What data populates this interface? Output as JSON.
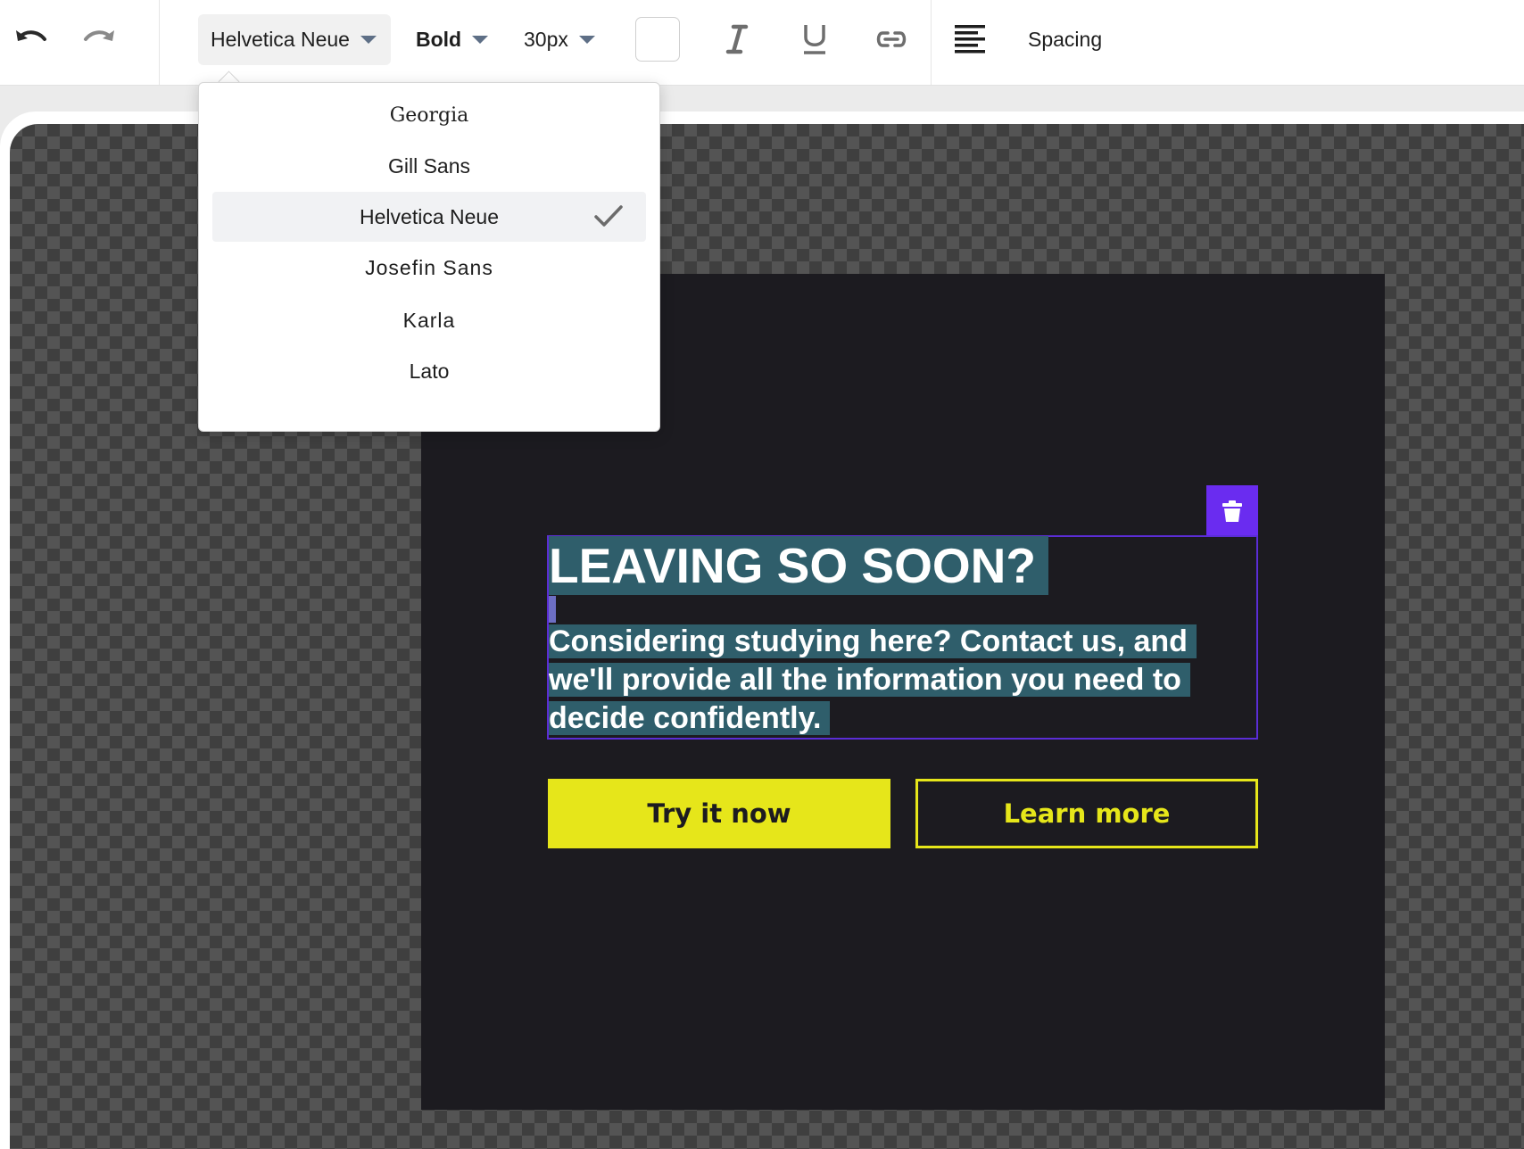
{
  "toolbar": {
    "font_family": "Helvetica Neue",
    "font_weight": "Bold",
    "font_size": "30px",
    "text_color": "#ffffff",
    "spacing_label": "Spacing"
  },
  "font_dropdown": {
    "options": [
      {
        "label": "Georgia",
        "selected": false
      },
      {
        "label": "Gill Sans",
        "selected": false
      },
      {
        "label": "Helvetica Neue",
        "selected": true
      },
      {
        "label": "Josefin Sans",
        "selected": false
      },
      {
        "label": "Karla",
        "selected": false
      },
      {
        "label": "Lato",
        "selected": false
      }
    ]
  },
  "popup": {
    "headline": "LEAVING SO SOON?",
    "body": "Considering studying here? Contact us, and we'll provide all the information you need to decide confidently.",
    "primary_button": "Try it now",
    "secondary_button": "Learn more"
  },
  "colors": {
    "accent": "#6a2cf0",
    "popup_background": "#1c1b20",
    "button_yellow": "#e6e61a",
    "text_selection": "#2f5e6b"
  },
  "icons": [
    "undo-icon",
    "redo-icon",
    "italic-icon",
    "underline-icon",
    "link-icon",
    "align-left-icon",
    "trash-icon",
    "checkmark-icon",
    "chevron-down-icon"
  ]
}
